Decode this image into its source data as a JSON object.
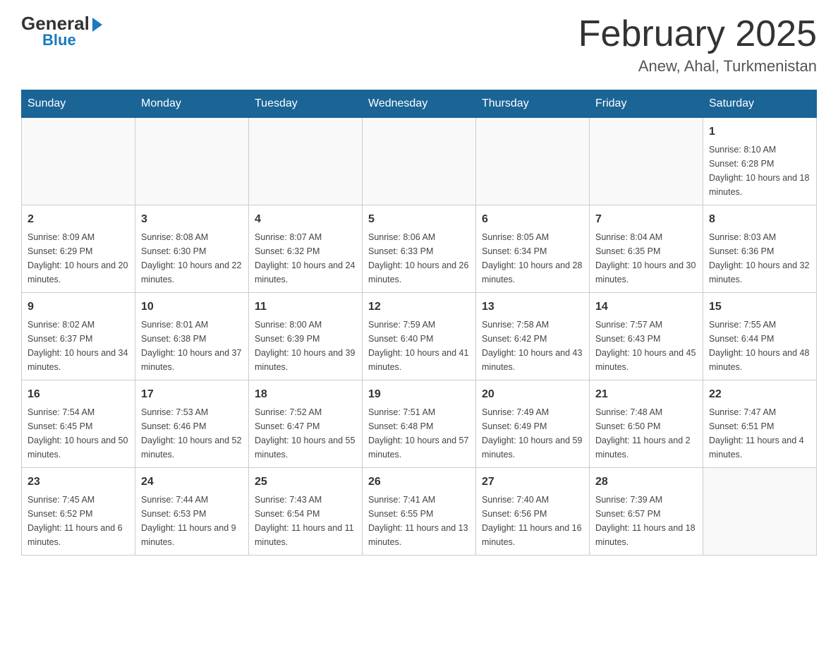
{
  "header": {
    "logo_general": "General",
    "logo_arrow": "▶",
    "logo_blue": "Blue",
    "month_title": "February 2025",
    "location": "Anew, Ahal, Turkmenistan"
  },
  "weekdays": [
    "Sunday",
    "Monday",
    "Tuesday",
    "Wednesday",
    "Thursday",
    "Friday",
    "Saturday"
  ],
  "weeks": [
    [
      {
        "day": "",
        "info": ""
      },
      {
        "day": "",
        "info": ""
      },
      {
        "day": "",
        "info": ""
      },
      {
        "day": "",
        "info": ""
      },
      {
        "day": "",
        "info": ""
      },
      {
        "day": "",
        "info": ""
      },
      {
        "day": "1",
        "info": "Sunrise: 8:10 AM\nSunset: 6:28 PM\nDaylight: 10 hours and 18 minutes."
      }
    ],
    [
      {
        "day": "2",
        "info": "Sunrise: 8:09 AM\nSunset: 6:29 PM\nDaylight: 10 hours and 20 minutes."
      },
      {
        "day": "3",
        "info": "Sunrise: 8:08 AM\nSunset: 6:30 PM\nDaylight: 10 hours and 22 minutes."
      },
      {
        "day": "4",
        "info": "Sunrise: 8:07 AM\nSunset: 6:32 PM\nDaylight: 10 hours and 24 minutes."
      },
      {
        "day": "5",
        "info": "Sunrise: 8:06 AM\nSunset: 6:33 PM\nDaylight: 10 hours and 26 minutes."
      },
      {
        "day": "6",
        "info": "Sunrise: 8:05 AM\nSunset: 6:34 PM\nDaylight: 10 hours and 28 minutes."
      },
      {
        "day": "7",
        "info": "Sunrise: 8:04 AM\nSunset: 6:35 PM\nDaylight: 10 hours and 30 minutes."
      },
      {
        "day": "8",
        "info": "Sunrise: 8:03 AM\nSunset: 6:36 PM\nDaylight: 10 hours and 32 minutes."
      }
    ],
    [
      {
        "day": "9",
        "info": "Sunrise: 8:02 AM\nSunset: 6:37 PM\nDaylight: 10 hours and 34 minutes."
      },
      {
        "day": "10",
        "info": "Sunrise: 8:01 AM\nSunset: 6:38 PM\nDaylight: 10 hours and 37 minutes."
      },
      {
        "day": "11",
        "info": "Sunrise: 8:00 AM\nSunset: 6:39 PM\nDaylight: 10 hours and 39 minutes."
      },
      {
        "day": "12",
        "info": "Sunrise: 7:59 AM\nSunset: 6:40 PM\nDaylight: 10 hours and 41 minutes."
      },
      {
        "day": "13",
        "info": "Sunrise: 7:58 AM\nSunset: 6:42 PM\nDaylight: 10 hours and 43 minutes."
      },
      {
        "day": "14",
        "info": "Sunrise: 7:57 AM\nSunset: 6:43 PM\nDaylight: 10 hours and 45 minutes."
      },
      {
        "day": "15",
        "info": "Sunrise: 7:55 AM\nSunset: 6:44 PM\nDaylight: 10 hours and 48 minutes."
      }
    ],
    [
      {
        "day": "16",
        "info": "Sunrise: 7:54 AM\nSunset: 6:45 PM\nDaylight: 10 hours and 50 minutes."
      },
      {
        "day": "17",
        "info": "Sunrise: 7:53 AM\nSunset: 6:46 PM\nDaylight: 10 hours and 52 minutes."
      },
      {
        "day": "18",
        "info": "Sunrise: 7:52 AM\nSunset: 6:47 PM\nDaylight: 10 hours and 55 minutes."
      },
      {
        "day": "19",
        "info": "Sunrise: 7:51 AM\nSunset: 6:48 PM\nDaylight: 10 hours and 57 minutes."
      },
      {
        "day": "20",
        "info": "Sunrise: 7:49 AM\nSunset: 6:49 PM\nDaylight: 10 hours and 59 minutes."
      },
      {
        "day": "21",
        "info": "Sunrise: 7:48 AM\nSunset: 6:50 PM\nDaylight: 11 hours and 2 minutes."
      },
      {
        "day": "22",
        "info": "Sunrise: 7:47 AM\nSunset: 6:51 PM\nDaylight: 11 hours and 4 minutes."
      }
    ],
    [
      {
        "day": "23",
        "info": "Sunrise: 7:45 AM\nSunset: 6:52 PM\nDaylight: 11 hours and 6 minutes."
      },
      {
        "day": "24",
        "info": "Sunrise: 7:44 AM\nSunset: 6:53 PM\nDaylight: 11 hours and 9 minutes."
      },
      {
        "day": "25",
        "info": "Sunrise: 7:43 AM\nSunset: 6:54 PM\nDaylight: 11 hours and 11 minutes."
      },
      {
        "day": "26",
        "info": "Sunrise: 7:41 AM\nSunset: 6:55 PM\nDaylight: 11 hours and 13 minutes."
      },
      {
        "day": "27",
        "info": "Sunrise: 7:40 AM\nSunset: 6:56 PM\nDaylight: 11 hours and 16 minutes."
      },
      {
        "day": "28",
        "info": "Sunrise: 7:39 AM\nSunset: 6:57 PM\nDaylight: 11 hours and 18 minutes."
      },
      {
        "day": "",
        "info": ""
      }
    ]
  ]
}
